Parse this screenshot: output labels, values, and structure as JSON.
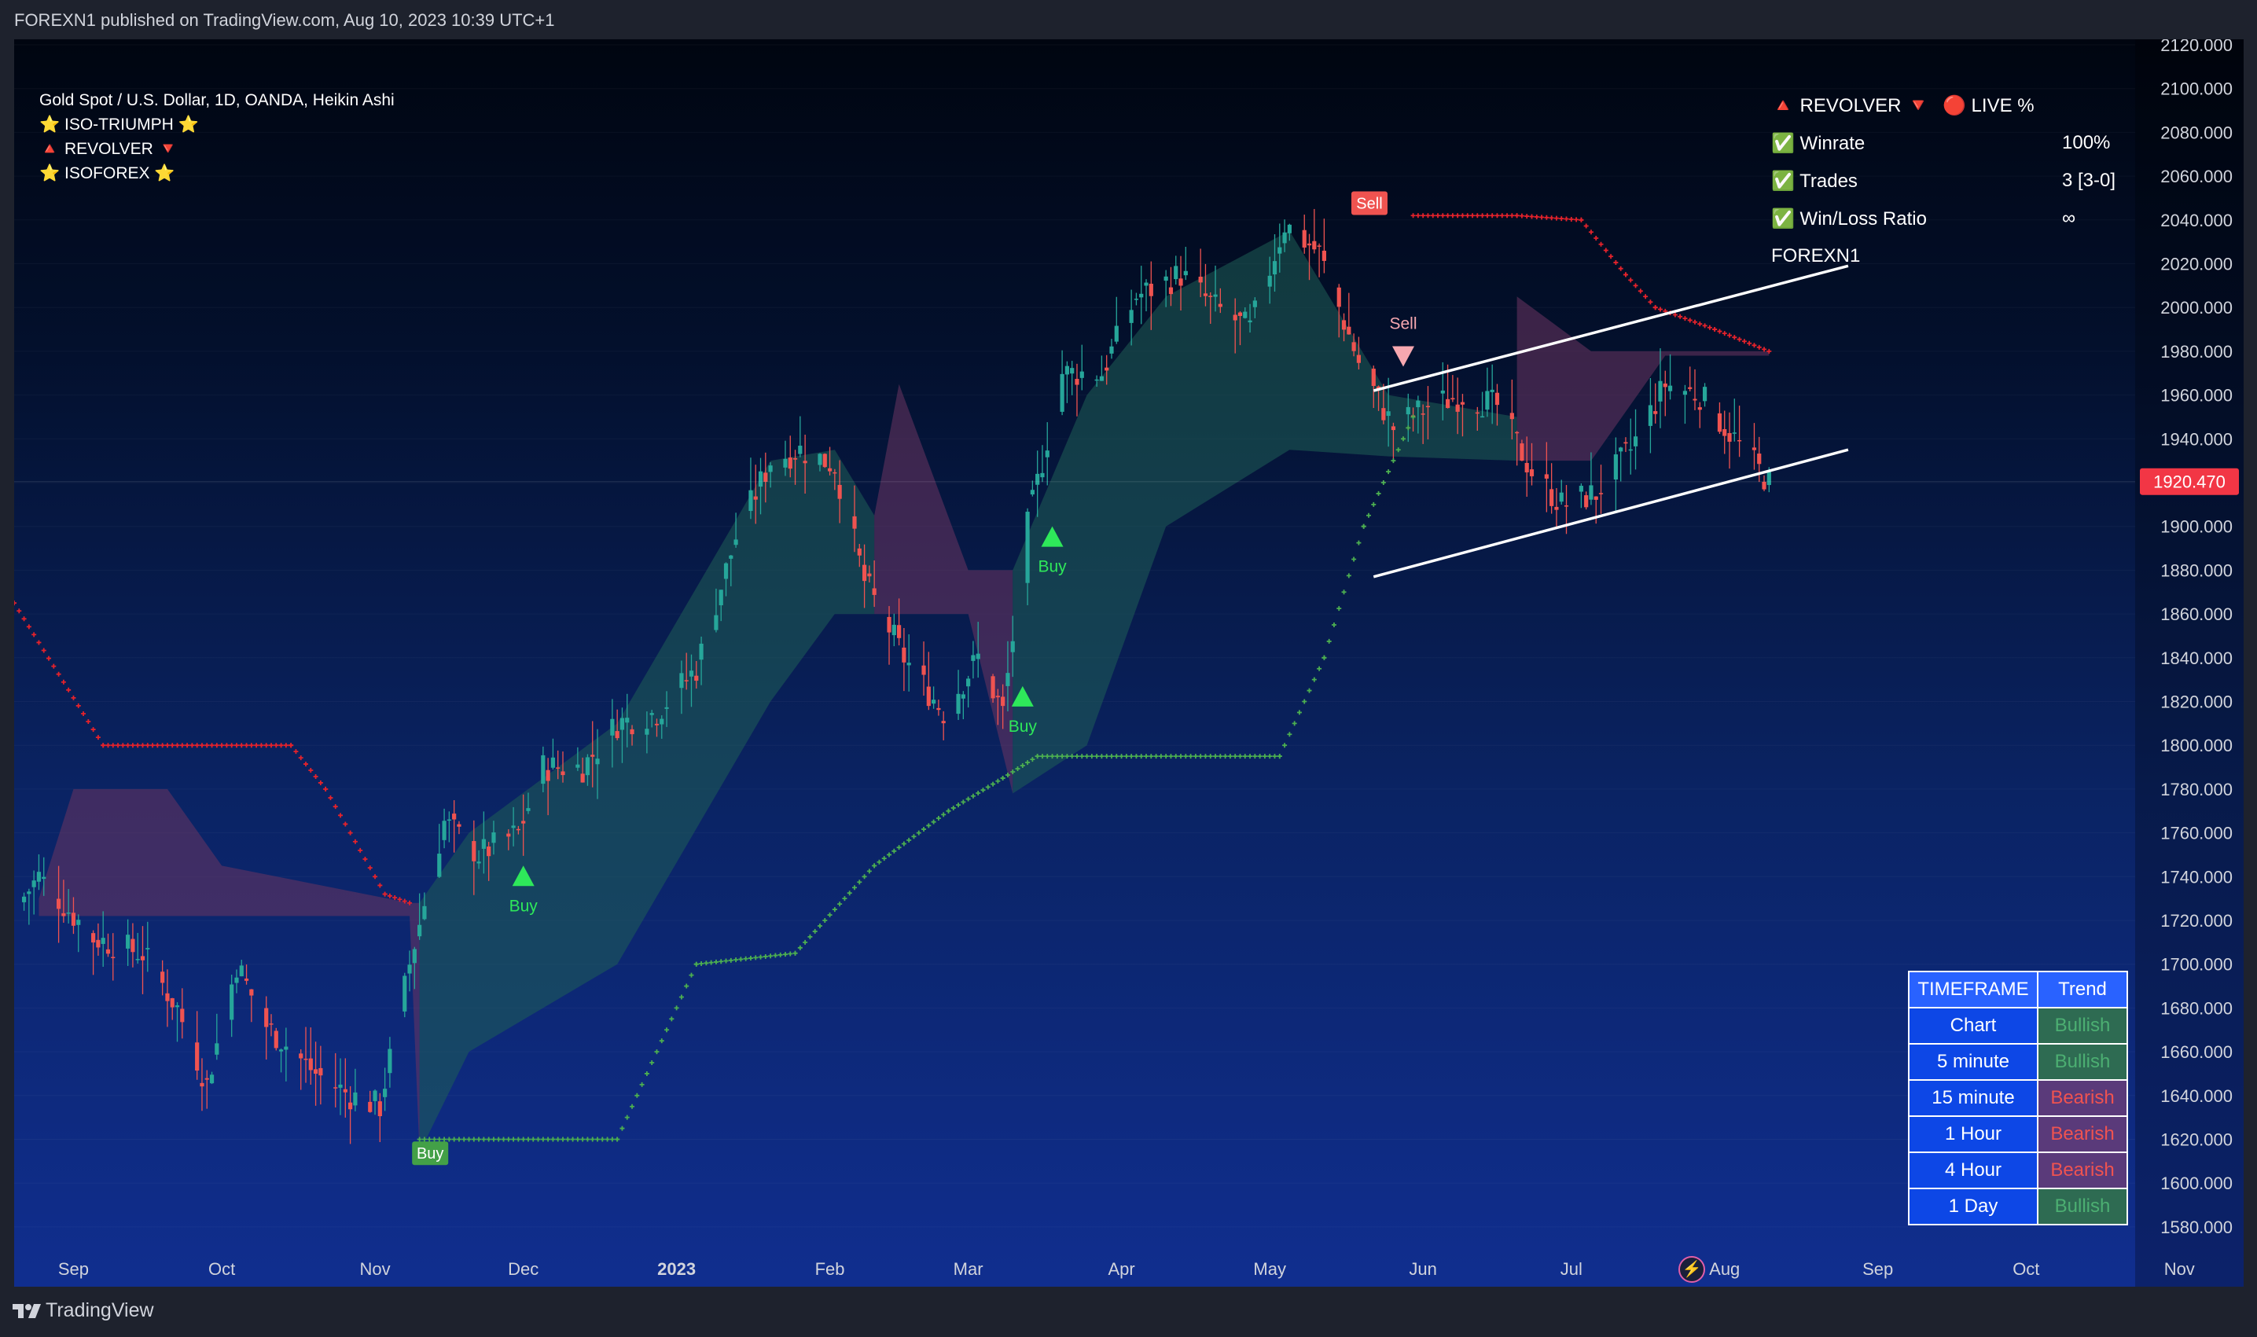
{
  "header": {
    "published": "FOREXN1 published on TradingView.com, Aug 10, 2023 10:39 UTC+1"
  },
  "footer": {
    "brand": "TradingView"
  },
  "legend": {
    "symbol": "Gold Spot / U.S. Dollar, 1D, OANDA, Heikin Ashi",
    "indicators": [
      "⭐ ISO-TRIUMPH ⭐",
      "🔺 REVOLVER 🔻",
      "⭐ ISOFOREX ⭐"
    ]
  },
  "stats_panel": {
    "title_left": "🔺 REVOLVER 🔻",
    "title_right": "🔴 LIVE %",
    "rows": [
      {
        "label": "✅ Winrate",
        "value": "100%"
      },
      {
        "label": "✅ Trades",
        "value": "3 [3-0]"
      },
      {
        "label": "✅ Win/Loss Ratio",
        "value": "∞"
      }
    ],
    "author": "FOREXN1"
  },
  "trend_table": {
    "headers": [
      "TIMEFRAME",
      "Trend"
    ],
    "rows": [
      {
        "timeframe": "Chart",
        "trend": "Bullish"
      },
      {
        "timeframe": "5 minute",
        "trend": "Bullish"
      },
      {
        "timeframe": "15 minute",
        "trend": "Bearish"
      },
      {
        "timeframe": "1 Hour",
        "trend": "Bearish"
      },
      {
        "timeframe": "4 Hour",
        "trend": "Bearish"
      },
      {
        "timeframe": "1 Day",
        "trend": "Bullish"
      }
    ]
  },
  "colors": {
    "bull": "#26a69a",
    "bear": "#ef5350",
    "support_line": "#4caf50",
    "resistance_line": "#e5222b",
    "cloud_bull": "#1f5e55",
    "cloud_bear": "#6b3560",
    "signal_buy": "#2ee85a",
    "signal_sell": "#f7a8b0",
    "price_tag": "#f23645"
  },
  "chart_data": {
    "type": "candlestick",
    "ylim": [
      1570,
      2125
    ],
    "y_ticks": [
      "2120.000",
      "2100.000",
      "2080.000",
      "2060.000",
      "2040.000",
      "2020.000",
      "2000.000",
      "1980.000",
      "1960.000",
      "1940.000",
      "1920.000",
      "1900.000",
      "1880.000",
      "1860.000",
      "1840.000",
      "1820.000",
      "1800.000",
      "1780.000",
      "1760.000",
      "1740.000",
      "1720.000",
      "1700.000",
      "1680.000",
      "1660.000",
      "1640.000",
      "1620.000",
      "1600.000",
      "1580.000"
    ],
    "x_ticks": [
      {
        "date": "2022-09-01",
        "label": "Sep"
      },
      {
        "date": "2022-10-01",
        "label": "Oct"
      },
      {
        "date": "2022-11-01",
        "label": "Nov"
      },
      {
        "date": "2022-12-01",
        "label": "Dec"
      },
      {
        "date": "2023-01-01",
        "label": "2023"
      },
      {
        "date": "2023-02-01",
        "label": "Feb"
      },
      {
        "date": "2023-03-01",
        "label": "Mar"
      },
      {
        "date": "2023-04-01",
        "label": "Apr"
      },
      {
        "date": "2023-05-01",
        "label": "May"
      },
      {
        "date": "2023-06-01",
        "label": "Jun"
      },
      {
        "date": "2023-07-01",
        "label": "Jul"
      },
      {
        "date": "2023-08-01",
        "label": "Aug"
      },
      {
        "date": "2023-09-01",
        "label": "Sep"
      },
      {
        "date": "2023-10-01",
        "label": "Oct"
      },
      {
        "date": "2023-11-01",
        "label": "Nov"
      }
    ],
    "x_range": [
      "2022-08-20",
      "2023-11-14"
    ],
    "last_price": "1920.470",
    "price_path": [
      [
        "2022-08-20",
        1725
      ],
      [
        "2022-08-25",
        1740
      ],
      [
        "2022-09-05",
        1712
      ],
      [
        "2022-09-15",
        1705
      ],
      [
        "2022-09-22",
        1680
      ],
      [
        "2022-09-28",
        1645
      ],
      [
        "2022-10-04",
        1700
      ],
      [
        "2022-10-10",
        1672
      ],
      [
        "2022-10-20",
        1650
      ],
      [
        "2022-10-27",
        1640
      ],
      [
        "2022-11-02",
        1635
      ],
      [
        "2022-11-08",
        1700
      ],
      [
        "2022-11-15",
        1765
      ],
      [
        "2022-11-22",
        1750
      ],
      [
        "2022-11-30",
        1760
      ],
      [
        "2022-12-05",
        1790
      ],
      [
        "2022-12-13",
        1790
      ],
      [
        "2022-12-20",
        1810
      ],
      [
        "2022-12-28",
        1815
      ],
      [
        "2023-01-05",
        1835
      ],
      [
        "2023-01-13",
        1895
      ],
      [
        "2023-01-20",
        1930
      ],
      [
        "2023-01-26",
        1935
      ],
      [
        "2023-02-02",
        1928
      ],
      [
        "2023-02-08",
        1875
      ],
      [
        "2023-02-16",
        1840
      ],
      [
        "2023-02-24",
        1815
      ],
      [
        "2023-03-03",
        1840
      ],
      [
        "2023-03-08",
        1815
      ],
      [
        "2023-03-13",
        1900
      ],
      [
        "2023-03-20",
        1970
      ],
      [
        "2023-03-28",
        1970
      ],
      [
        "2023-04-04",
        2005
      ],
      [
        "2023-04-13",
        2015
      ],
      [
        "2023-04-20",
        2000
      ],
      [
        "2023-04-27",
        1990
      ],
      [
        "2023-05-04",
        2038
      ],
      [
        "2023-05-11",
        2025
      ],
      [
        "2023-05-19",
        1975
      ],
      [
        "2023-05-26",
        1945
      ],
      [
        "2023-06-02",
        1955
      ],
      [
        "2023-06-09",
        1960
      ],
      [
        "2023-06-16",
        1955
      ],
      [
        "2023-06-23",
        1925
      ],
      [
        "2023-06-29",
        1910
      ],
      [
        "2023-07-06",
        1915
      ],
      [
        "2023-07-13",
        1935
      ],
      [
        "2023-07-20",
        1965
      ],
      [
        "2023-07-27",
        1960
      ],
      [
        "2023-08-03",
        1940
      ],
      [
        "2023-08-10",
        1920
      ]
    ],
    "support_trail": [
      [
        "2022-11-10",
        1620
      ],
      [
        "2022-12-20",
        1620
      ],
      [
        "2023-01-05",
        1700
      ],
      [
        "2023-01-25",
        1705
      ],
      [
        "2023-02-10",
        1745
      ],
      [
        "2023-02-25",
        1770
      ],
      [
        "2023-03-08",
        1785
      ],
      [
        "2023-03-15",
        1795
      ],
      [
        "2023-05-03",
        1795
      ],
      [
        "2023-05-12",
        1840
      ],
      [
        "2023-05-20",
        1900
      ],
      [
        "2023-05-30",
        1950
      ]
    ],
    "resistance_trail": [
      [
        "2022-08-20",
        1865
      ],
      [
        "2022-09-07",
        1800
      ],
      [
        "2022-10-15",
        1800
      ],
      [
        "2022-10-22",
        1780
      ],
      [
        "2022-11-03",
        1732
      ],
      [
        "2022-11-08",
        1728
      ],
      [
        "2023-05-30",
        2042
      ],
      [
        "2023-06-20",
        2042
      ],
      [
        "2023-07-03",
        2040
      ],
      [
        "2023-07-12",
        2015
      ],
      [
        "2023-07-18",
        2000
      ],
      [
        "2023-07-30",
        1990
      ],
      [
        "2023-08-10",
        1980
      ]
    ],
    "clouds": [
      {
        "kind": "bear",
        "points": [
          [
            "2022-08-25",
            1722,
            1730
          ],
          [
            "2022-09-01",
            1722,
            1780
          ],
          [
            "2022-09-20",
            1722,
            1780
          ],
          [
            "2022-10-01",
            1722,
            1745
          ],
          [
            "2022-11-08",
            1722,
            1728
          ],
          [
            "2022-11-10",
            1614,
            1728
          ]
        ]
      },
      {
        "kind": "bull",
        "points": [
          [
            "2022-11-10",
            1614,
            1728
          ],
          [
            "2022-11-20",
            1660,
            1760
          ],
          [
            "2022-12-20",
            1700,
            1810
          ],
          [
            "2023-01-20",
            1820,
            1930
          ],
          [
            "2023-02-02",
            1860,
            1935
          ],
          [
            "2023-02-10",
            1860,
            1905
          ]
        ]
      },
      {
        "kind": "bear",
        "points": [
          [
            "2023-02-10",
            1860,
            1905
          ],
          [
            "2023-02-15",
            1860,
            1965
          ],
          [
            "2023-03-01",
            1860,
            1880
          ],
          [
            "2023-03-10",
            1778,
            1880
          ]
        ]
      },
      {
        "kind": "bull",
        "points": [
          [
            "2023-03-10",
            1778,
            1880
          ],
          [
            "2023-03-25",
            1800,
            1960
          ],
          [
            "2023-04-10",
            1900,
            2005
          ],
          [
            "2023-05-05",
            1935,
            2035
          ],
          [
            "2023-05-25",
            1932,
            1960
          ],
          [
            "2023-06-20",
            1930,
            1950
          ]
        ]
      },
      {
        "kind": "bear",
        "points": [
          [
            "2023-06-20",
            1930,
            2005
          ],
          [
            "2023-07-05",
            1930,
            1980
          ],
          [
            "2023-07-20",
            1978,
            1980
          ],
          [
            "2023-08-10",
            1978,
            1980
          ]
        ]
      }
    ],
    "trend_channel": {
      "upper": [
        [
          "2023-05-22",
          1962
        ],
        [
          "2023-08-26",
          2019
        ]
      ],
      "lower": [
        [
          "2023-05-22",
          1877
        ],
        [
          "2023-08-26",
          1935
        ]
      ]
    },
    "signals": [
      {
        "kind": "buy-flag",
        "date": "2022-11-12",
        "price": 1614,
        "label": "Buy"
      },
      {
        "kind": "buy",
        "date": "2022-12-01",
        "price": 1740,
        "label": "Buy"
      },
      {
        "kind": "buy",
        "date": "2023-03-12",
        "price": 1822,
        "label": "Buy"
      },
      {
        "kind": "buy",
        "date": "2023-03-18",
        "price": 1895,
        "label": "Buy"
      },
      {
        "kind": "sell",
        "date": "2023-05-28",
        "price": 1978,
        "label": "Sell"
      },
      {
        "kind": "sell-flag",
        "date": "2023-05-21",
        "price": 2048,
        "label": "Sell"
      }
    ]
  }
}
